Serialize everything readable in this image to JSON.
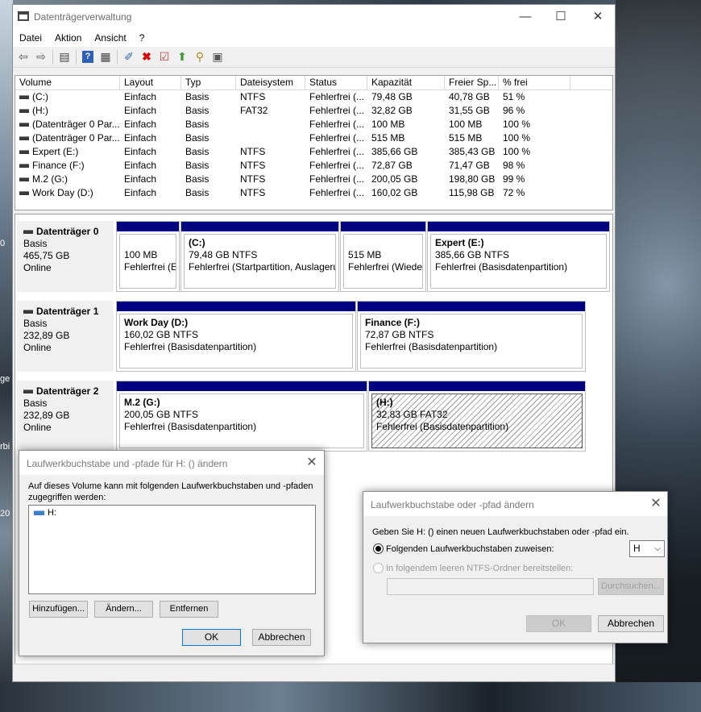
{
  "window": {
    "title": "Datenträgerverwaltung",
    "minimize": "—",
    "maximize": "☐",
    "close": "✕"
  },
  "menu": [
    "Datei",
    "Aktion",
    "Ansicht",
    "?"
  ],
  "list": {
    "columns": [
      "Volume",
      "Layout",
      "Typ",
      "Dateisystem",
      "Status",
      "Kapazität",
      "Freier Sp...",
      "% frei"
    ],
    "rows": [
      [
        "(C:)",
        "Einfach",
        "Basis",
        "NTFS",
        "Fehlerfrei (...",
        "79,48 GB",
        "40,78 GB",
        "51 %"
      ],
      [
        "(H:)",
        "Einfach",
        "Basis",
        "FAT32",
        "Fehlerfrei (...",
        "32,82 GB",
        "31,55 GB",
        "96 %"
      ],
      [
        "(Datenträger 0 Par...",
        "Einfach",
        "Basis",
        "",
        "Fehlerfrei (...",
        "100 MB",
        "100 MB",
        "100 %"
      ],
      [
        "(Datenträger 0 Par...",
        "Einfach",
        "Basis",
        "",
        "Fehlerfrei (...",
        "515 MB",
        "515 MB",
        "100 %"
      ],
      [
        "Expert (E:)",
        "Einfach",
        "Basis",
        "NTFS",
        "Fehlerfrei (...",
        "385,66 GB",
        "385,43 GB",
        "100 %"
      ],
      [
        "Finance (F:)",
        "Einfach",
        "Basis",
        "NTFS",
        "Fehlerfrei (...",
        "72,87 GB",
        "71,47 GB",
        "98 %"
      ],
      [
        "M.2 (G:)",
        "Einfach",
        "Basis",
        "NTFS",
        "Fehlerfrei (...",
        "200,05 GB",
        "198,80 GB",
        "99 %"
      ],
      [
        "Work Day (D:)",
        "Einfach",
        "Basis",
        "NTFS",
        "Fehlerfrei (...",
        "160,02 GB",
        "115,98 GB",
        "72 %"
      ]
    ]
  },
  "disks": [
    {
      "name": "Datenträger 0",
      "type": "Basis",
      "size": "465,75 GB",
      "status": "Online",
      "partitions": [
        {
          "name": "",
          "size": "100 MB",
          "status": "Fehlerfrei (EI"
        },
        {
          "name": "(C:)",
          "size": "79,48 GB NTFS",
          "status": "Fehlerfrei (Startpartition, Auslagerur"
        },
        {
          "name": "",
          "size": "515 MB",
          "status": "Fehlerfrei (Wieder"
        },
        {
          "name": "Expert  (E:)",
          "size": "385,66 GB NTFS",
          "status": "Fehlerfrei (Basisdatenpartition)"
        }
      ]
    },
    {
      "name": "Datenträger 1",
      "type": "Basis",
      "size": "232,89 GB",
      "status": "Online",
      "partitions": [
        {
          "name": "Work Day  (D:)",
          "size": "160,02 GB NTFS",
          "status": "Fehlerfrei (Basisdatenpartition)"
        },
        {
          "name": "Finance  (F:)",
          "size": "72,87 GB NTFS",
          "status": "Fehlerfrei (Basisdatenpartition)"
        }
      ]
    },
    {
      "name": "Datenträger 2",
      "type": "Basis",
      "size": "232,89 GB",
      "status": "Online",
      "partitions": [
        {
          "name": "M.2  (G:)",
          "size": "200,05 GB NTFS",
          "status": "Fehlerfrei (Basisdatenpartition)"
        },
        {
          "name": "(H:)",
          "size": "32,83 GB FAT32",
          "status": "Fehlerfrei (Basisdatenpartition)"
        }
      ]
    }
  ],
  "dialog1": {
    "title": "Laufwerkbuchstabe und -pfade für H: () ändern",
    "description": "Auf dieses Volume kann mit folgenden Laufwerkbuchstaben und -pfaden zugegriffen werden:",
    "entries": [
      "H:"
    ],
    "add_label": "Hinzufügen...",
    "change_label": "Ändern...",
    "remove_label": "Entfernen",
    "ok_label": "OK",
    "cancel_label": "Abbrechen"
  },
  "dialog2": {
    "title": "Laufwerkbuchstabe oder -pfad ändern",
    "prompt": "Geben Sie H: () einen neuen Laufwerkbuchstaben oder -pfad ein.",
    "option_letter": "Folgenden Laufwerkbuchstaben zuweisen:",
    "selected_letter": "H",
    "option_folder": "In folgendem leeren NTFS-Ordner bereitstellen:",
    "browse_label": "Durchsuchen...",
    "ok_label": "OK",
    "cancel_label": "Abbrechen"
  },
  "desktop_fragments": [
    "0",
    "ge",
    "rbi",
    "20"
  ]
}
